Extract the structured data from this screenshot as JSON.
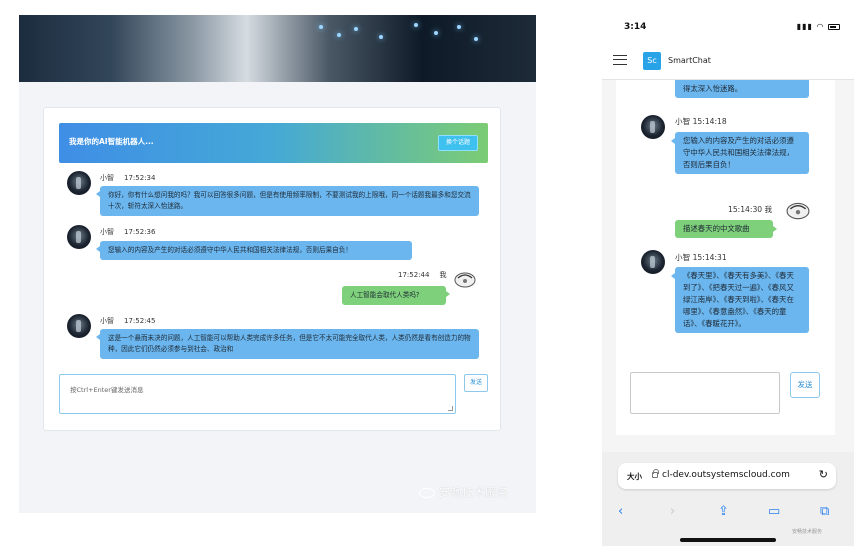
{
  "desktop": {
    "header_title": "我是你的AI智能机器人...",
    "topic_button": "换个话题",
    "messages": [
      {
        "sender": "小智",
        "time": "17:52:34",
        "text": "你好，你有什么想问我的吗？我可以回答很多问题，但是有使用频率限制，不要测试我的上限哦，同一个话题我最多和您交流十次，斩符太深入怡迷路。"
      },
      {
        "sender": "小智",
        "time": "17:52:36",
        "text": "您输入的内容及产生的对话必须遵守中华人民共和国相关法律法规，否则后果自负！"
      },
      {
        "sender": "我",
        "time": "17:52:44",
        "text": "人工智能会取代人类吗?"
      },
      {
        "sender": "小智",
        "time": "17:52:45",
        "text": "这是一个悬而未决的问题，人工智能可以帮助人类完成许多任务，但是它不太可能完全取代人类，人类仍然是看有创造力的物种，因此它们仍然必须参与到社会、政治和"
      }
    ],
    "input_placeholder": "按Ctrl+Enter键发送消息",
    "send_label": "发送",
    "watermark": "安畅技术服务"
  },
  "mobile": {
    "status_time": "3:14",
    "app_logo": "Sc",
    "app_name": "SmartChat",
    "prev_tail": "得太深入怡迷路。",
    "messages": [
      {
        "meta": "小智 15:14:18",
        "text": "您输入的内容及产生的对话必须遵守中华人民共和国相关法律法规，否则后果自负！"
      },
      {
        "meta": "15:14:30 我",
        "text": "描述春天的中文歌曲"
      },
      {
        "meta": "小智 15:14:31",
        "text": "《春天里》、《春天有多美》、《春天到了》、《把春天过一遍》、《春风又绿江南岸》、《春天到啦》、《春天在哪里》、《春意盎然》、《春天的童话》、《春暖花开》。"
      }
    ],
    "send_label": "发送",
    "url_aa": "大小",
    "url_text": "cl-dev.outsystemscloud.com",
    "watermark": "安畅技术服务"
  },
  "colors": {
    "bot_bubble": "#6bb6ee",
    "user_bubble": "#7ed07a",
    "accent_blue": "#2b8fd6"
  }
}
